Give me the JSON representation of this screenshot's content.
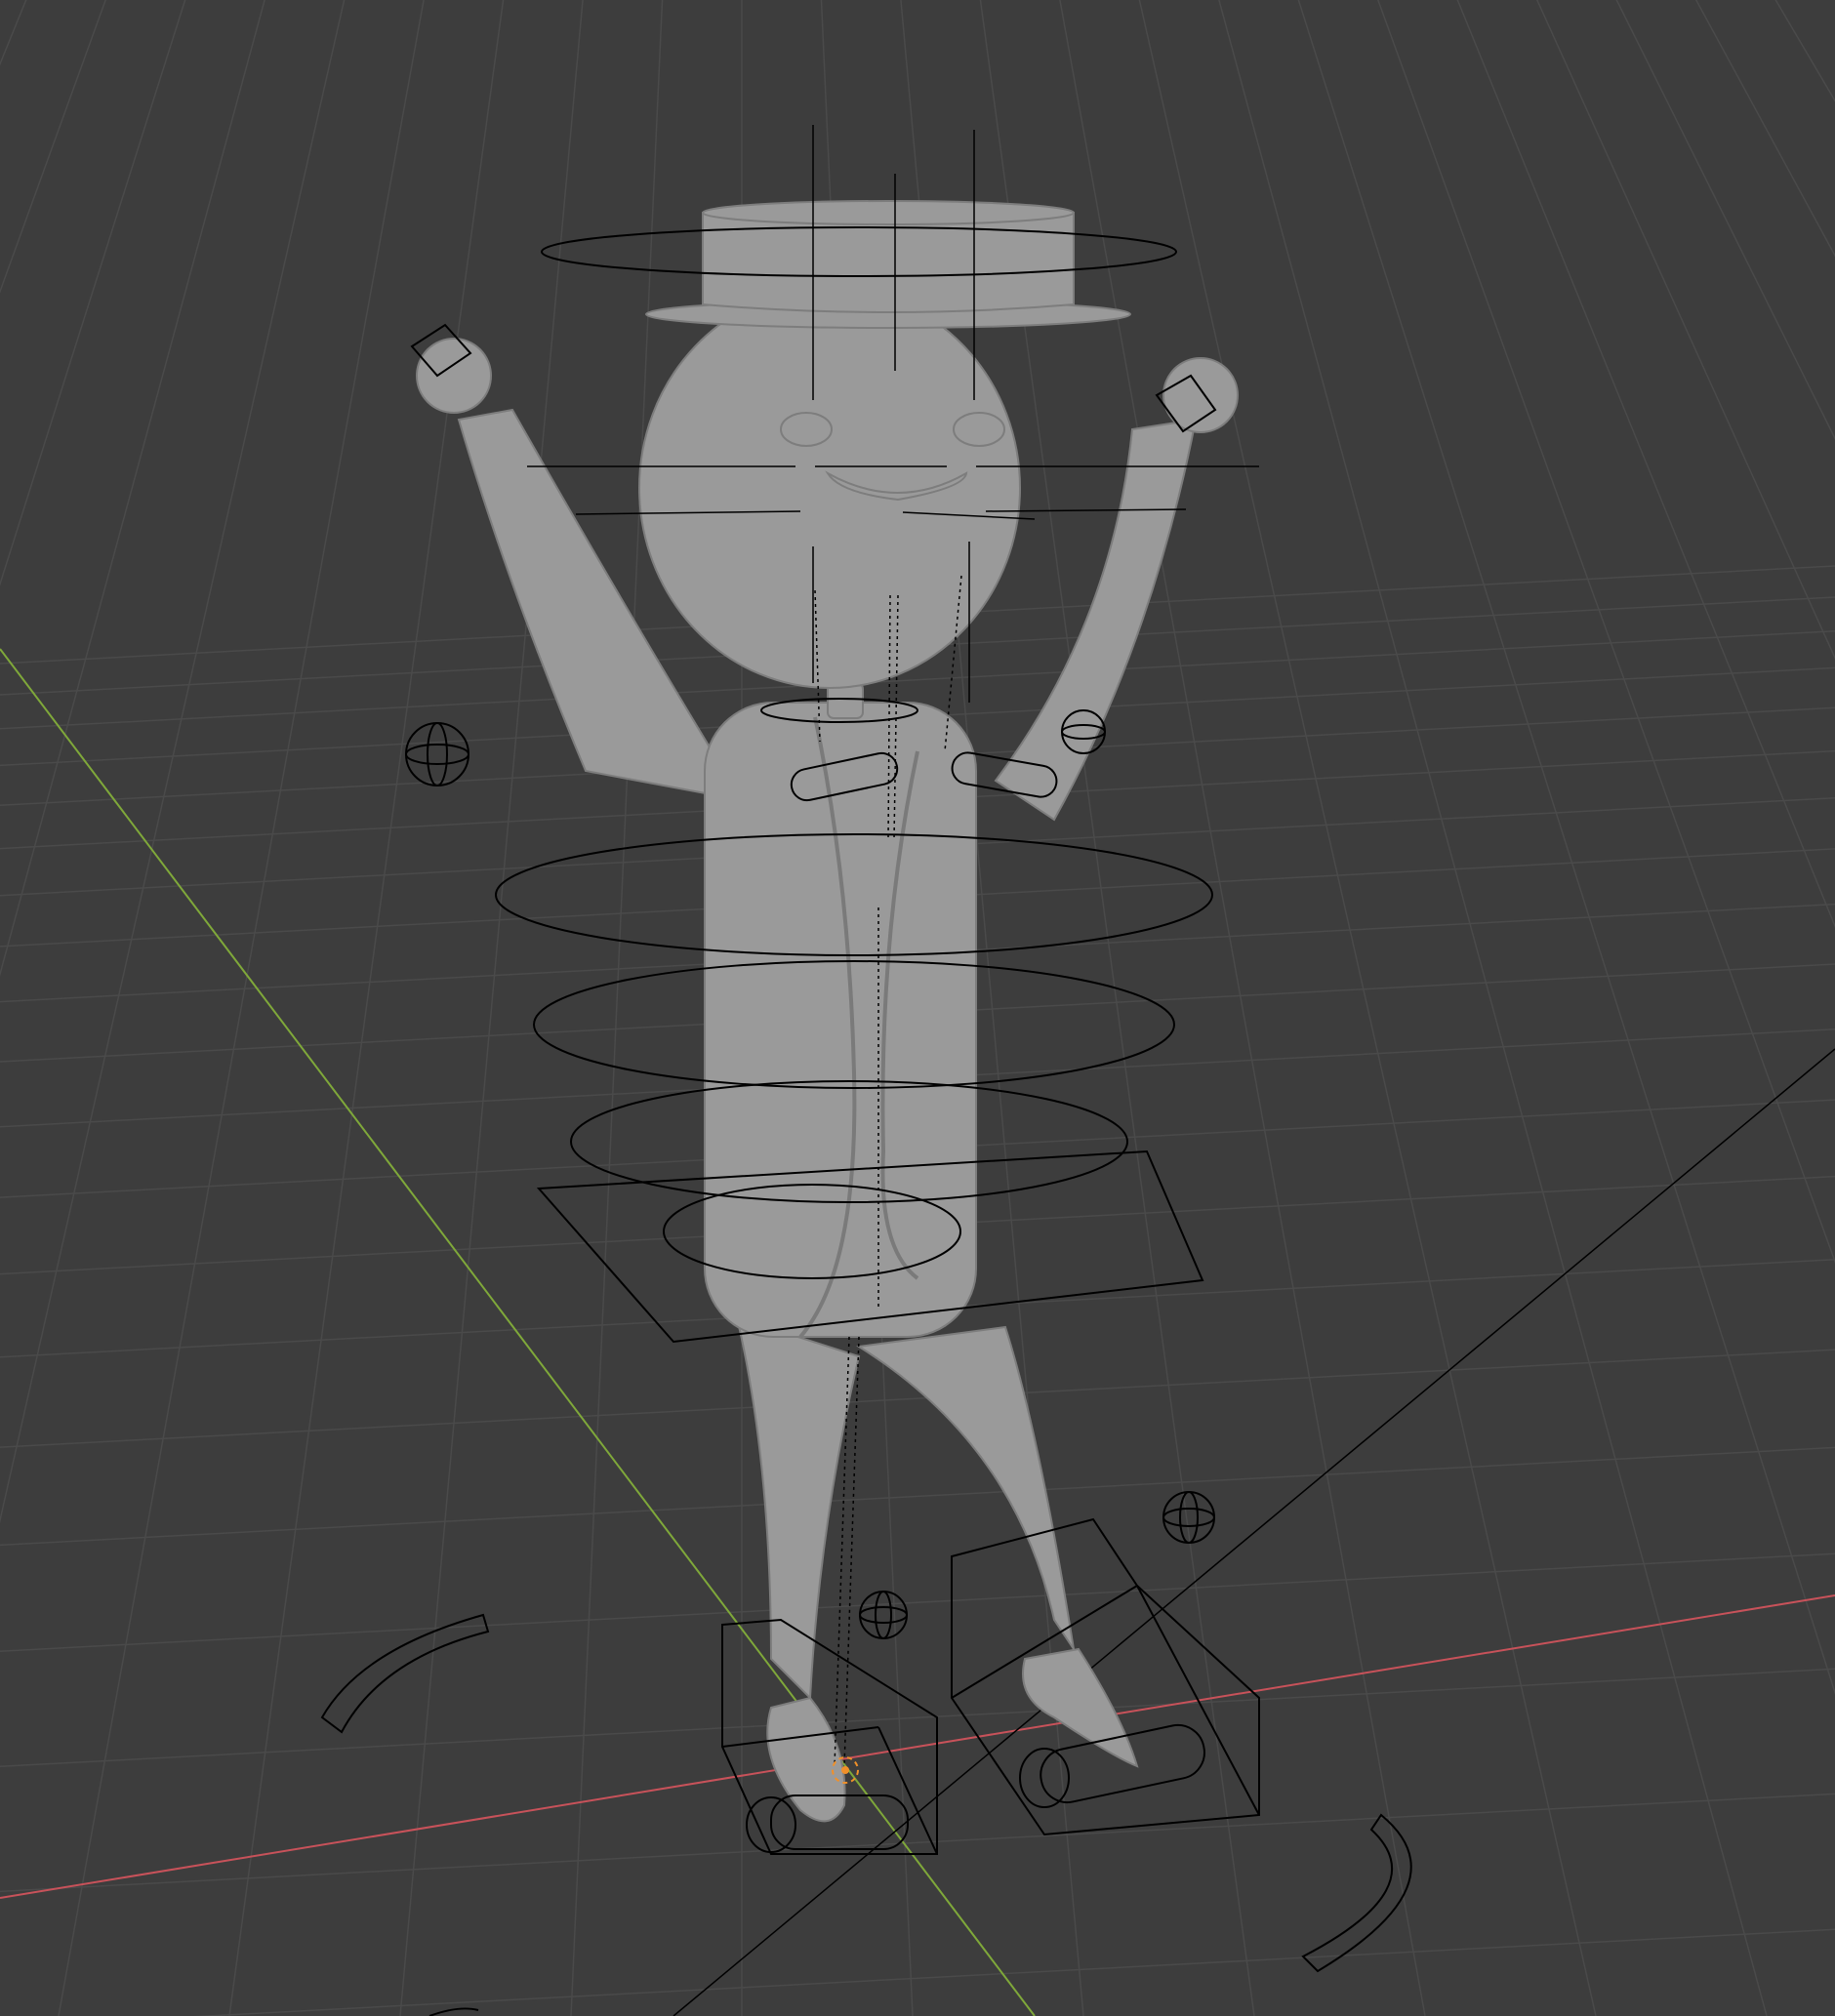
{
  "viewport": {
    "background": "#3d3d3d",
    "grid_color": "#4a4a4a",
    "x_axis_color": "#c8525a",
    "y_axis_color": "#7fa83a",
    "mesh_color": "#9a9a9a",
    "control_color": "#000000",
    "origin_color": "#f0902a"
  },
  "scene": {
    "object": "rigged-character",
    "parts": [
      "hat",
      "head",
      "eyes",
      "smile",
      "torso",
      "jacket",
      "arms",
      "hands",
      "legs",
      "feet"
    ],
    "controls": [
      "head-circle",
      "spine-circles",
      "hip-square",
      "foot-ik-boxes",
      "pole-targets",
      "hand-cubes",
      "shoulder-capsules",
      "knee-arcs"
    ],
    "origin_marker": "3d-cursor"
  }
}
